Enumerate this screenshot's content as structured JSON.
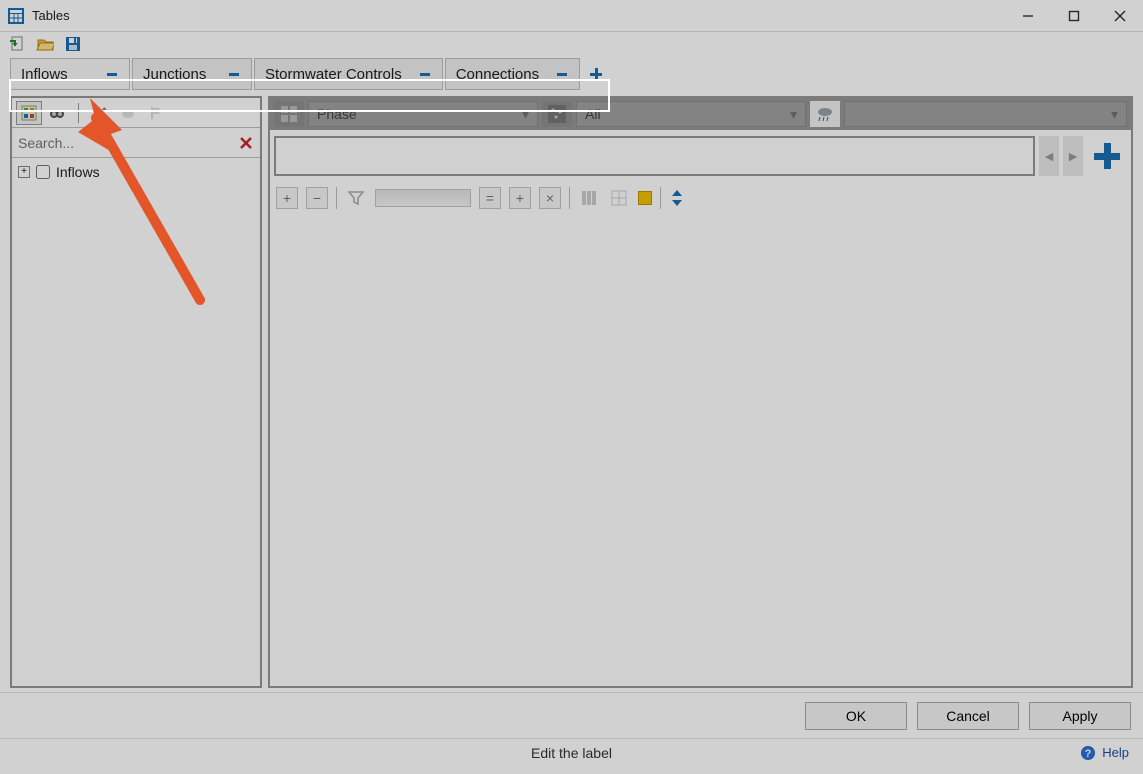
{
  "window": {
    "title": "Tables"
  },
  "tabs": [
    {
      "label": "Inflows"
    },
    {
      "label": "Junctions"
    },
    {
      "label": "Stormwater Controls"
    },
    {
      "label": "Connections"
    }
  ],
  "left": {
    "search_placeholder": "Search...",
    "tree_root": "Inflows"
  },
  "right": {
    "phase_label": "Phase",
    "filter2": "All"
  },
  "buttons": {
    "ok": "OK",
    "cancel": "Cancel",
    "apply": "Apply"
  },
  "status": {
    "hint": "Edit the label",
    "help": "Help"
  }
}
